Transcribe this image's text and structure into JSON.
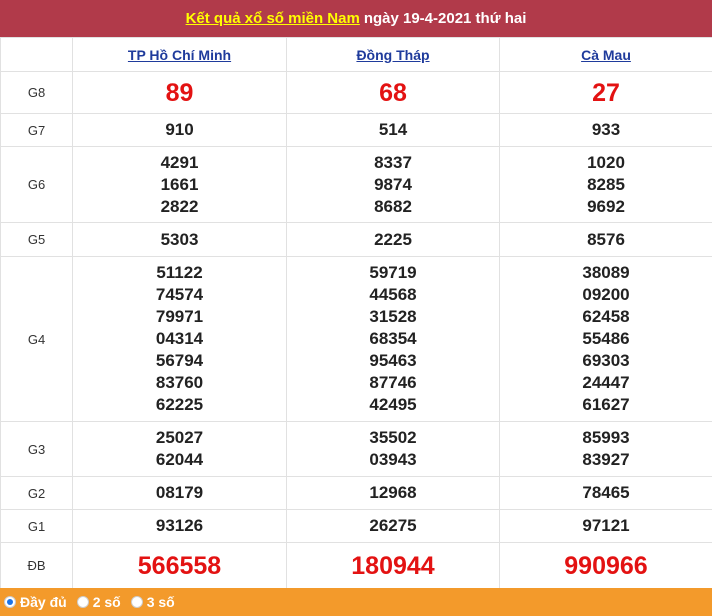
{
  "title": {
    "link": "Kết quả xổ số miền Nam",
    "rest": "ngày 19-4-2021 thứ hai"
  },
  "provinces": [
    "TP Hồ Chí Minh",
    "Đồng Tháp",
    "Cà Mau"
  ],
  "prizes": [
    {
      "label": "G8",
      "values": [
        [
          "89"
        ],
        [
          "68"
        ],
        [
          "27"
        ]
      ]
    },
    {
      "label": "G7",
      "values": [
        [
          "910"
        ],
        [
          "514"
        ],
        [
          "933"
        ]
      ]
    },
    {
      "label": "G6",
      "values": [
        [
          "4291",
          "1661",
          "2822"
        ],
        [
          "8337",
          "9874",
          "8682"
        ],
        [
          "1020",
          "8285",
          "9692"
        ]
      ]
    },
    {
      "label": "G5",
      "values": [
        [
          "5303"
        ],
        [
          "2225"
        ],
        [
          "8576"
        ]
      ]
    },
    {
      "label": "G4",
      "values": [
        [
          "51122",
          "74574",
          "79971",
          "04314",
          "56794",
          "83760",
          "62225"
        ],
        [
          "59719",
          "44568",
          "31528",
          "68354",
          "95463",
          "87746",
          "42495"
        ],
        [
          "38089",
          "09200",
          "62458",
          "55486",
          "69303",
          "24447",
          "61627"
        ]
      ]
    },
    {
      "label": "G3",
      "values": [
        [
          "25027",
          "62044"
        ],
        [
          "35502",
          "03943"
        ],
        [
          "85993",
          "83927"
        ]
      ]
    },
    {
      "label": "G2",
      "values": [
        [
          "08179"
        ],
        [
          "12968"
        ],
        [
          "78465"
        ]
      ]
    },
    {
      "label": "G1",
      "values": [
        [
          "93126"
        ],
        [
          "26275"
        ],
        [
          "97121"
        ]
      ]
    },
    {
      "label": "ĐB",
      "values": [
        [
          "566558"
        ],
        [
          "180944"
        ],
        [
          "990966"
        ]
      ]
    }
  ],
  "footer": {
    "options": [
      {
        "label": "Đầy đủ",
        "selected": true
      },
      {
        "label": "2 số",
        "selected": false
      },
      {
        "label": "3 số",
        "selected": false
      }
    ]
  }
}
